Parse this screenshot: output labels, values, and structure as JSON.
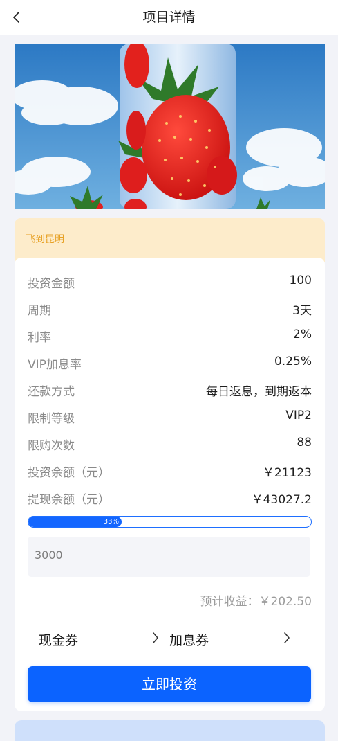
{
  "header": {
    "title": "项目详情"
  },
  "project": {
    "name": "飞到昆明"
  },
  "details": [
    {
      "label": "投资金额",
      "value": "100"
    },
    {
      "label": "周期",
      "value": "3天"
    },
    {
      "label": "利率",
      "value": "2%"
    },
    {
      "label": "VIP加息率",
      "value": "0.25%"
    },
    {
      "label": "还款方式",
      "value": "每日返息，到期返本"
    },
    {
      "label": "限制等级",
      "value": "VIP2"
    },
    {
      "label": "限购次数",
      "value": "88"
    },
    {
      "label": "投资余额（元）",
      "value": "￥21123"
    },
    {
      "label": "提现余额（元）",
      "value": "￥43027.2"
    }
  ],
  "progress": {
    "percent": 33,
    "label": "33%"
  },
  "amount_input": {
    "value": "3000"
  },
  "expected_return": "预计收益：￥202.50",
  "coupons": {
    "cash_label": "现金券",
    "interest_label": "加息券"
  },
  "invest_button": "立即投资",
  "icons": {
    "back": "chevron-left-icon",
    "coupon_arrow": "chevron-right-icon"
  },
  "colors": {
    "primary": "#0b63ff",
    "name_card_bg": "#fdeccb",
    "name_text": "#e7a125"
  }
}
